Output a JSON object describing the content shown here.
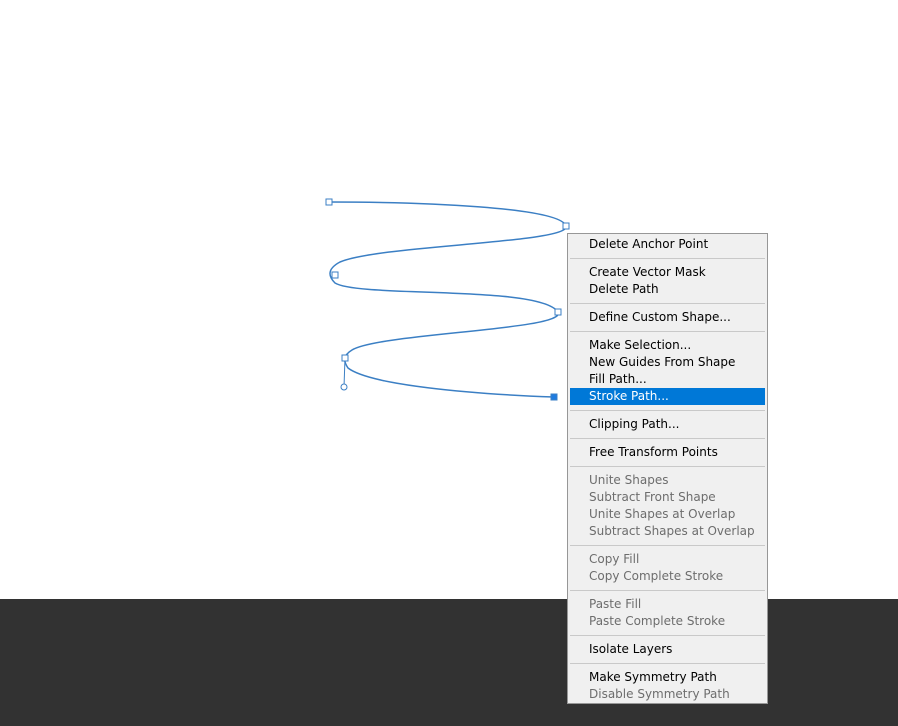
{
  "colors": {
    "path_stroke": "#3b7fc4",
    "menu_background": "#f0f0f0",
    "menu_highlight": "#0078d7",
    "panel_dark": "#323232",
    "disabled_text": "#6d6d6d"
  },
  "canvas": {
    "path": {
      "anchors": [
        {
          "name": "anchor-point-1",
          "selected": false
        },
        {
          "name": "anchor-point-2",
          "selected": false
        },
        {
          "name": "anchor-point-3",
          "selected": false
        },
        {
          "name": "anchor-point-4",
          "selected": false
        },
        {
          "name": "anchor-point-5",
          "selected": false
        },
        {
          "name": "anchor-point-6",
          "selected": true
        }
      ],
      "handles": [
        {
          "name": "direction-handle",
          "for_anchor": 5
        }
      ]
    }
  },
  "context_menu": {
    "groups": [
      [
        {
          "label": "Delete Anchor Point",
          "enabled": true
        }
      ],
      [
        {
          "label": "Create Vector Mask",
          "enabled": true
        },
        {
          "label": "Delete Path",
          "enabled": true
        }
      ],
      [
        {
          "label": "Define Custom Shape...",
          "enabled": true
        }
      ],
      [
        {
          "label": "Make Selection...",
          "enabled": true
        },
        {
          "label": "New Guides From Shape",
          "enabled": true
        },
        {
          "label": "Fill Path...",
          "enabled": true
        },
        {
          "label": "Stroke Path...",
          "enabled": true,
          "highlighted": true
        }
      ],
      [
        {
          "label": "Clipping Path...",
          "enabled": true
        }
      ],
      [
        {
          "label": "Free Transform Points",
          "enabled": true
        }
      ],
      [
        {
          "label": "Unite Shapes",
          "enabled": false
        },
        {
          "label": "Subtract Front Shape",
          "enabled": false
        },
        {
          "label": "Unite Shapes at Overlap",
          "enabled": false
        },
        {
          "label": "Subtract Shapes at Overlap",
          "enabled": false
        }
      ],
      [
        {
          "label": "Copy Fill",
          "enabled": false
        },
        {
          "label": "Copy Complete Stroke",
          "enabled": false
        }
      ],
      [
        {
          "label": "Paste Fill",
          "enabled": false
        },
        {
          "label": "Paste Complete Stroke",
          "enabled": false
        }
      ],
      [
        {
          "label": "Isolate Layers",
          "enabled": true
        }
      ],
      [
        {
          "label": "Make Symmetry Path",
          "enabled": true
        },
        {
          "label": "Disable Symmetry Path",
          "enabled": false
        }
      ]
    ]
  }
}
